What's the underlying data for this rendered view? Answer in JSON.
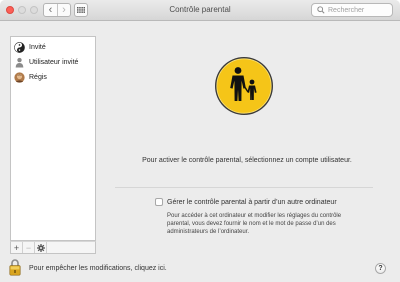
{
  "titlebar": {
    "title": "Contrôle parental",
    "back_glyph": "‹",
    "forward_glyph": "›",
    "search_placeholder": "Rechercher"
  },
  "sidebar": {
    "users": [
      {
        "label": "Invité",
        "icon": "guest-yin-yang-icon"
      },
      {
        "label": "Utilisateur invité",
        "icon": "guest-user-silhouette-icon"
      },
      {
        "label": "Régis",
        "icon": "user-photo-avatar"
      }
    ],
    "add_glyph": "+",
    "remove_glyph": "−"
  },
  "main": {
    "message": "Pour activer le contrôle parental, sélectionnez un compte utilisateur.",
    "remote_checkbox_label": "Gérer le contrôle parental à partir d’un autre ordinateur",
    "remote_checked": false,
    "remote_description": "Pour accéder à cet ordinateur et modifier les réglages du contrôle parental, vous devez fournir le nom et le mot de passe d’un des administrateurs de l’ordinateur."
  },
  "bottom": {
    "lock_text": "Pour empêcher les modifications, cliquez ici.",
    "help_glyph": "?"
  },
  "colors": {
    "parental_yellow": "#f5c518",
    "close_red": "#fc5f57",
    "window_bg": "#ececec"
  }
}
